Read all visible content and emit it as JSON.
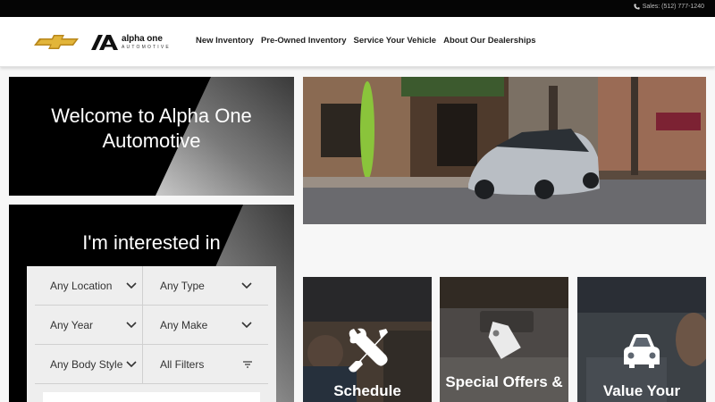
{
  "topbar": {
    "phone_text": "Sales: (512) 777-1240"
  },
  "header": {
    "dealer_name": "alpha one",
    "dealer_sub": "AUTOMOTIVE",
    "nav": [
      {
        "label": "New Inventory"
      },
      {
        "label": "Pre-Owned Inventory"
      },
      {
        "label": "Service Your Vehicle"
      },
      {
        "label": "About Our Dealerships"
      }
    ]
  },
  "welcome": {
    "title": "Welcome to Alpha One Automotive"
  },
  "interest": {
    "title": "I'm interested in",
    "filters": [
      {
        "left": "Any Location",
        "right": "Any Type"
      },
      {
        "left": "Any Year",
        "right": "Any Make"
      },
      {
        "left": "Any Body Style",
        "right": "All Filters"
      }
    ]
  },
  "cards": [
    {
      "label": "Schedule",
      "icon": "wrench-screwdriver-icon"
    },
    {
      "label": "Special Offers &",
      "icon": "price-tag-icon"
    },
    {
      "label": "Value Your",
      "icon": "car-icon"
    }
  ],
  "colors": {
    "topbar": "#050505",
    "panel": "#000000",
    "chevy_gold": "#d9a826",
    "filter_bg": "#eeeeee"
  }
}
